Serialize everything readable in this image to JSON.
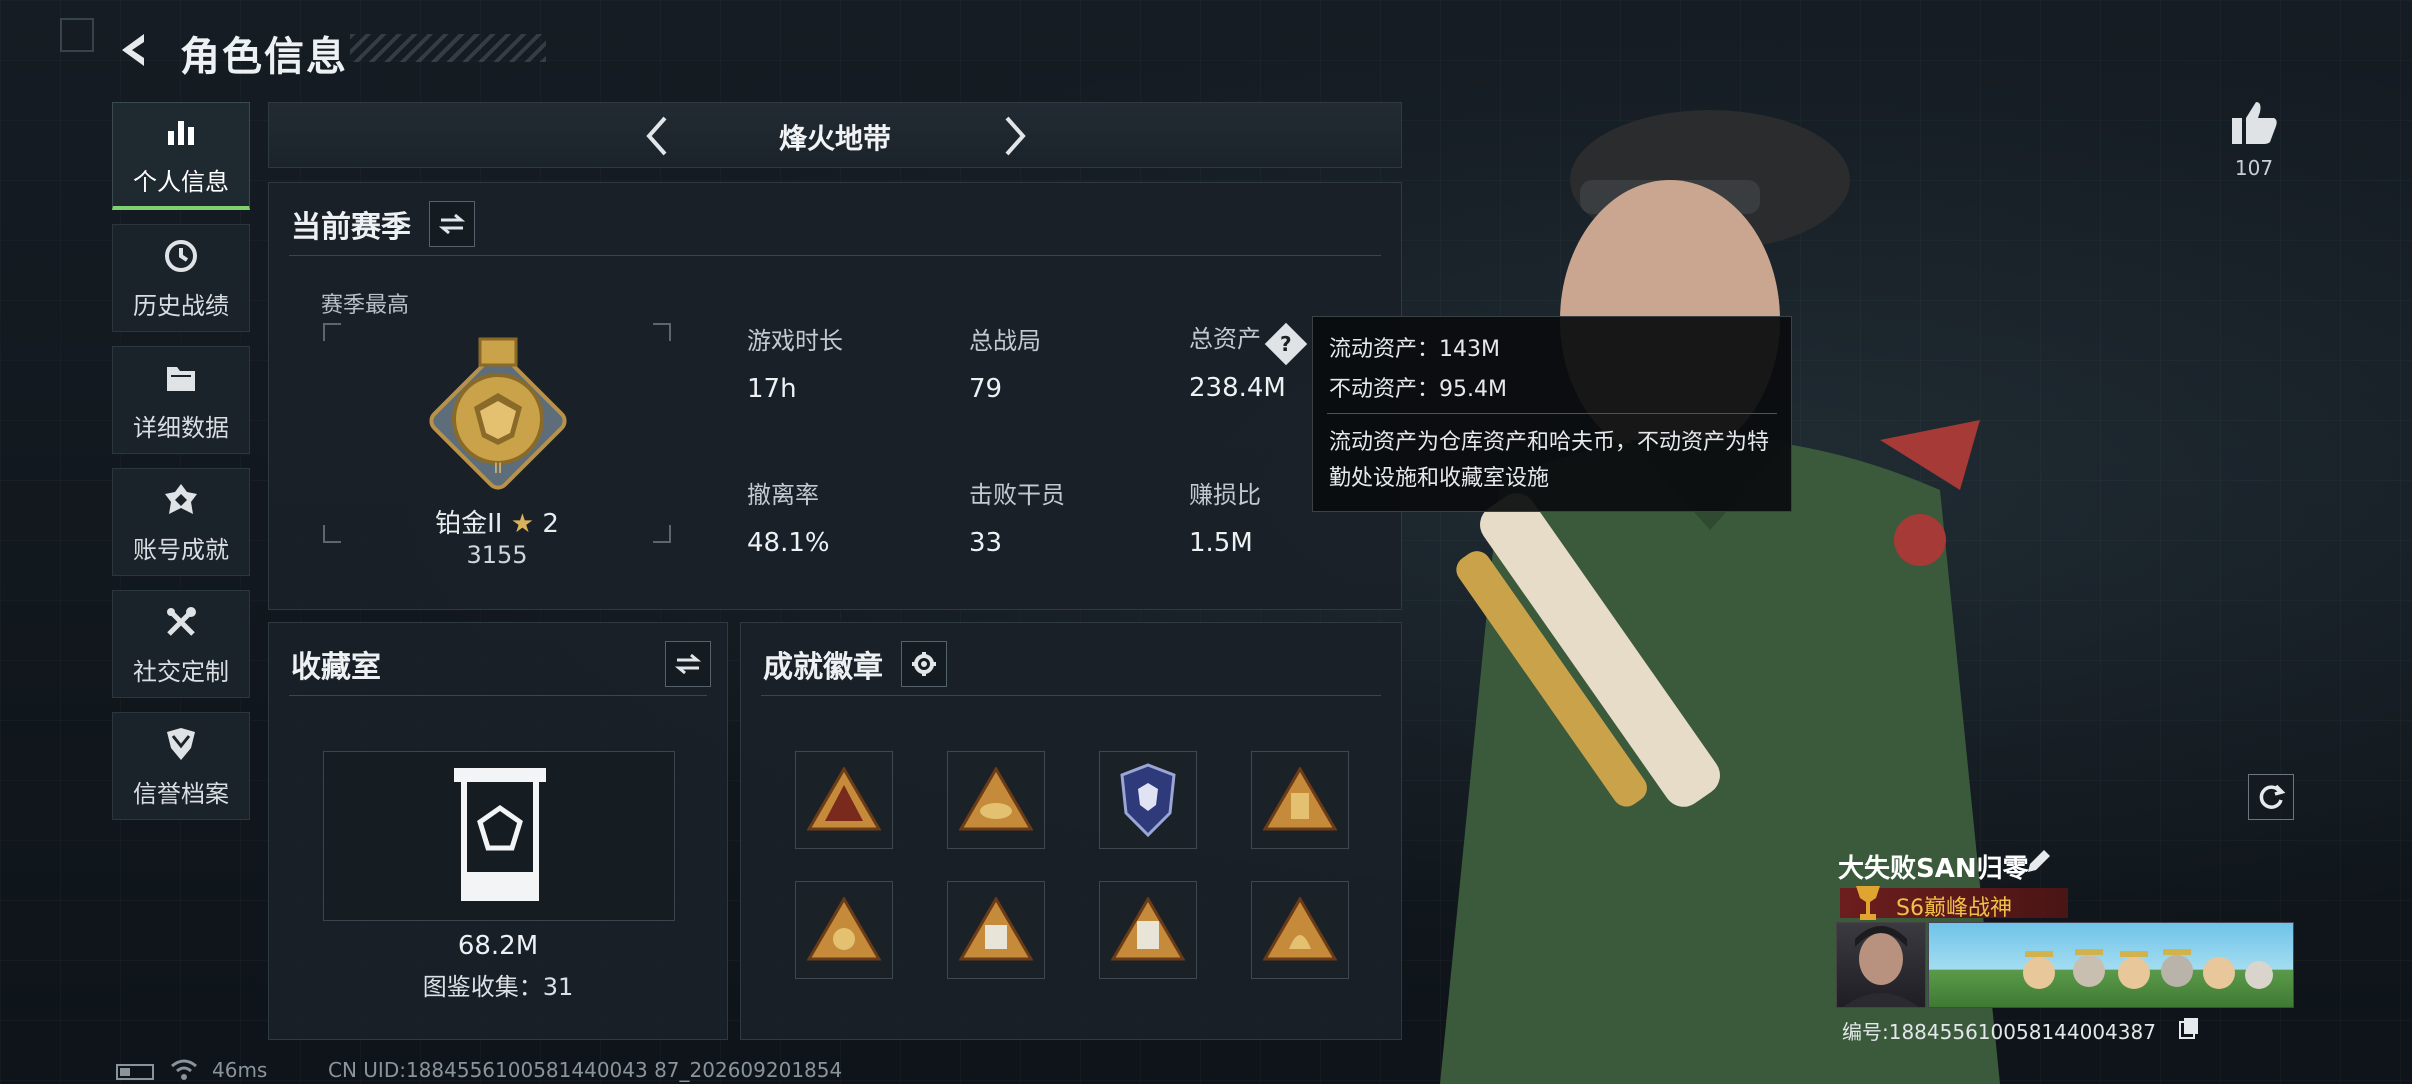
{
  "header": {
    "title": "角色信息"
  },
  "sidebar": {
    "items": [
      {
        "label": "个人信息",
        "icon": "bar-chart-icon",
        "active": true
      },
      {
        "label": "历史战绩",
        "icon": "history-clock-icon",
        "active": false
      },
      {
        "label": "详细数据",
        "icon": "folder-icon",
        "active": false
      },
      {
        "label": "账号成就",
        "icon": "achievement-icon",
        "active": false
      },
      {
        "label": "社交定制",
        "icon": "tools-icon",
        "active": false
      },
      {
        "label": "信誉档案",
        "icon": "credit-shield-icon",
        "active": false
      }
    ]
  },
  "mode": {
    "title": "烽火地带"
  },
  "season": {
    "title": "当前赛季",
    "best_label": "赛季最高",
    "rank": "铂金II",
    "stars": "2",
    "points": "3155",
    "stats": [
      {
        "label": "游戏时长",
        "value": "17h"
      },
      {
        "label": "总战局",
        "value": "79"
      },
      {
        "label": "总资产",
        "value": "238.4M"
      },
      {
        "label": "撤离率",
        "value": "48.1%"
      },
      {
        "label": "击败干员",
        "value": "33"
      },
      {
        "label": "赚损比",
        "value": "1.5M"
      }
    ]
  },
  "tooltip": {
    "liquid": "流动资产：143M",
    "fixed": "不动资产：95.4M",
    "desc": "流动资产为仓库资产和哈夫币，不动资产为特勤处设施和收藏室设施"
  },
  "collection": {
    "title": "收藏室",
    "value": "68.2M",
    "count": "图鉴收集：31"
  },
  "achievements": {
    "title": "成就徽章"
  },
  "profile": {
    "likes": "107",
    "name": "大失败SAN归零",
    "title_badge": "S6巅峰战神",
    "id_text": "编号:1884556100581440043​87"
  },
  "footer": {
    "ping": "46ms",
    "uid": "CN UID:1884556100581440043 87_202609201854"
  },
  "colors": {
    "accent_green": "#7fd06e",
    "badge_gold": "#c9a24a",
    "title_red": "#6d1d1d"
  }
}
